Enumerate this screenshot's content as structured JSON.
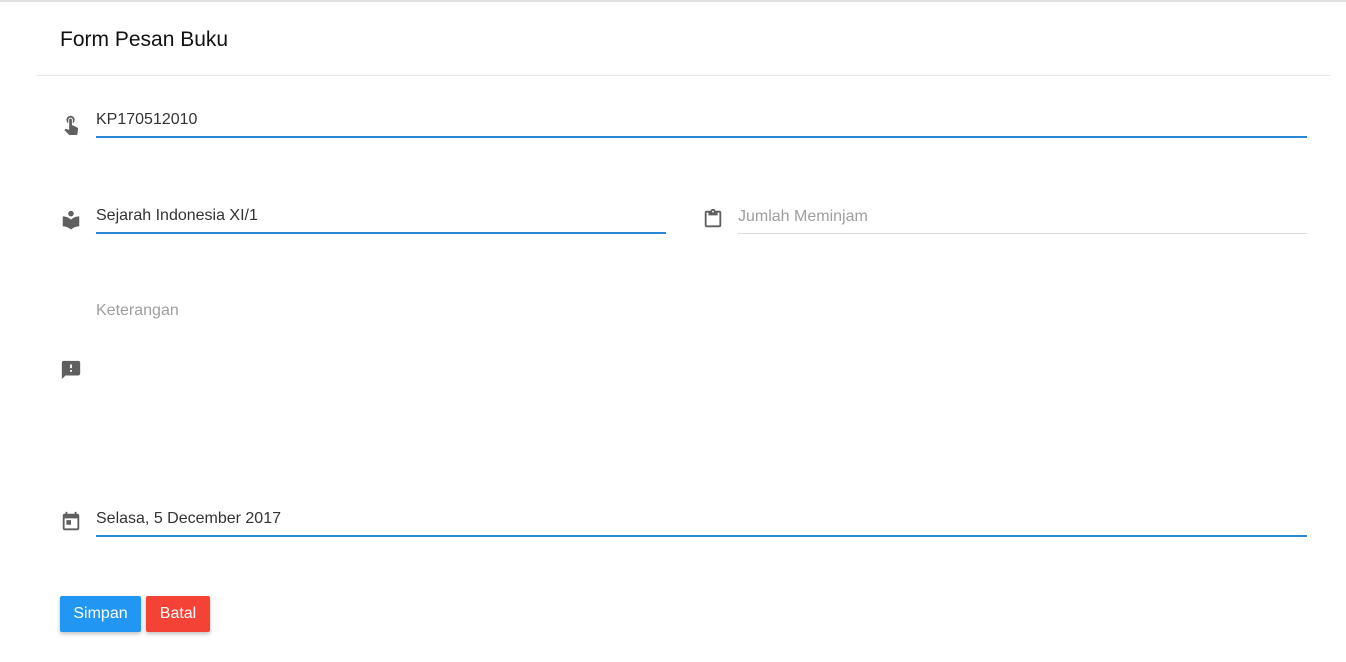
{
  "form": {
    "title": "Form Pesan Buku",
    "member": {
      "value": "KP170512010",
      "placeholder": "",
      "icon": "touch-hand-icon"
    },
    "book": {
      "value": "Sejarah Indonesia XI/1",
      "placeholder": "",
      "icon": "book-reader-icon"
    },
    "quantity": {
      "value": "",
      "placeholder": "Jumlah Meminjam",
      "icon": "clipboard-icon"
    },
    "notes": {
      "value": "",
      "placeholder": "Keterangan",
      "icon": "feedback-icon"
    },
    "date": {
      "value": "Selasa, 5 December 2017",
      "placeholder": "",
      "icon": "calendar-icon"
    },
    "buttons": {
      "save_label": "Simpan",
      "cancel_label": "Batal"
    }
  },
  "colors": {
    "accent": "#2b86d6",
    "save_button": "#2196f3",
    "cancel_button": "#f44336",
    "icon": "#5f5f5f"
  }
}
